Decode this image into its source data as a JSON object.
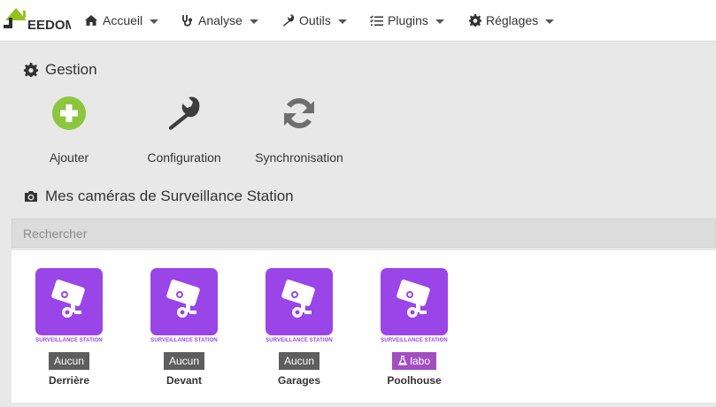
{
  "navbar": {
    "logo_text": "EEDOM",
    "items": [
      {
        "label": "Accueil",
        "icon": "home-icon"
      },
      {
        "label": "Analyse",
        "icon": "stethoscope-icon"
      },
      {
        "label": "Outils",
        "icon": "wrench-icon"
      },
      {
        "label": "Plugins",
        "icon": "tasks-icon"
      },
      {
        "label": "Réglages",
        "icon": "cog-icon"
      }
    ]
  },
  "gestion": {
    "title": "Gestion",
    "actions": [
      {
        "label": "Ajouter",
        "icon": "plus-circle-icon",
        "color": "#8cc63f"
      },
      {
        "label": "Configuration",
        "icon": "wrench-icon",
        "color": "#3d3d3d"
      },
      {
        "label": "Synchronisation",
        "icon": "refresh-icon",
        "color": "#6e6e6e"
      }
    ]
  },
  "cameras": {
    "title": "Mes caméras de Surveillance Station",
    "search_placeholder": "Rechercher",
    "brand_caption": "SURVEILLANCE STATION",
    "items": [
      {
        "name": "Derrière",
        "badge": "Aucun",
        "badge_type": "default"
      },
      {
        "name": "Devant",
        "badge": "Aucun",
        "badge_type": "default"
      },
      {
        "name": "Garages",
        "badge": "Aucun",
        "badge_type": "default"
      },
      {
        "name": "Poolhouse",
        "badge": "labo",
        "badge_type": "labo"
      }
    ]
  },
  "colors": {
    "accent_purple": "#9a45e8",
    "badge_gray": "#5e5e5e",
    "badge_labo": "#a24ec0",
    "add_green": "#8cc63f"
  }
}
